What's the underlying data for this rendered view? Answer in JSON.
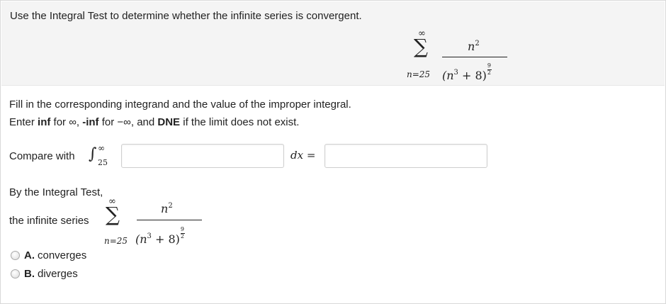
{
  "prompt": {
    "text": "Use the Integral Test to determine whether the infinite series is convergent."
  },
  "series": {
    "upper": "∞",
    "lower": "n=25",
    "numerator": "n",
    "numerator_exp": "2",
    "den_base": "(n",
    "den_base_exp": "3",
    "den_rest": " + 8)",
    "den_exp_num": "9",
    "den_exp_den": "2"
  },
  "instructions": {
    "line1": "Fill in the corresponding integrand and the value of the improper integral.",
    "line2_a": "Enter ",
    "inf": "inf",
    "line2_b": " for ∞, ",
    "neg_inf": "-inf",
    "line2_c": " for −∞, and ",
    "dne": "DNE",
    "line2_d": " if the limit does not exist."
  },
  "compare": {
    "label": "Compare with",
    "integral_sign": "∫",
    "upper": "∞",
    "lower": "25",
    "integrand_value": "",
    "dx": "dx =",
    "result_value": ""
  },
  "conclusion": {
    "line1": "By the Integral Test,",
    "line2": "the infinite series"
  },
  "options": [
    {
      "letter": "A.",
      "text": "converges"
    },
    {
      "letter": "B.",
      "text": "diverges"
    }
  ]
}
